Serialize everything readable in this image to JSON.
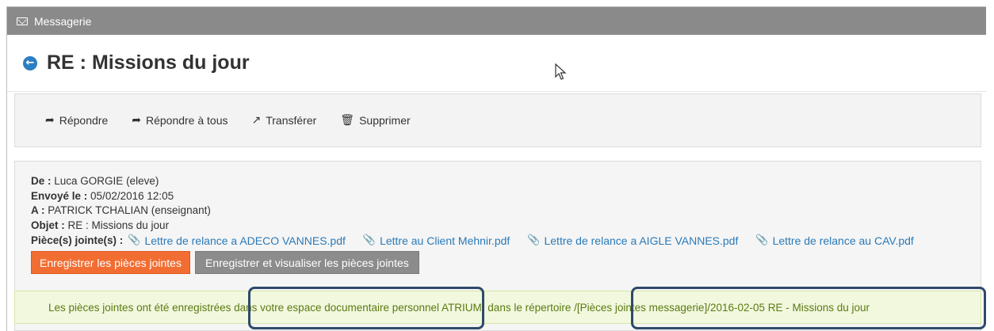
{
  "topbar": {
    "title": "Messagerie",
    "icon": "envelope-icon"
  },
  "header": {
    "title": "RE : Missions du jour",
    "back_icon": "back-arrow-icon"
  },
  "toolbar": {
    "reply": "Répondre",
    "reply_all": "Répondre à tous",
    "forward": "Transférer",
    "delete": "Supprimer"
  },
  "message": {
    "from_label": "De :",
    "from": "Luca GORGIE (eleve)",
    "sent_label": "Envoyé le :",
    "sent": "05/02/2016 12:05",
    "to_label": "A :",
    "to": "PATRICK TCHALIAN (enseignant)",
    "subject_label": "Objet :",
    "subject": "RE : Missions du jour",
    "attachments_label": "Pièce(s) jointe(s) :",
    "attachments": [
      "Lettre de relance a ADECO VANNES.pdf",
      "Lettre au Client Mehnir.pdf",
      "Lettre de relance a AIGLE VANNES.pdf",
      "Lettre de relance au CAV.pdf"
    ]
  },
  "actions": {
    "save_attachments": "Enregistrer les pièces jointes",
    "save_and_view": "Enregistrer et visualiser les pièces jointes"
  },
  "notice": {
    "text": "Les pièces jointes ont été enregistrées dans votre espace documentaire personnel ATRIUM, dans le répertoire /[Pièces jointes messagerie]/2016-02-05 RE - Missions du jour"
  },
  "colors": {
    "accent_blue": "#2c7ec2",
    "orange_button": "#f26d32",
    "gray_button": "#8c8c8c",
    "notice_bg": "#f2f8de",
    "notice_text": "#5a7a12",
    "highlight_border": "#2e4a6a"
  }
}
